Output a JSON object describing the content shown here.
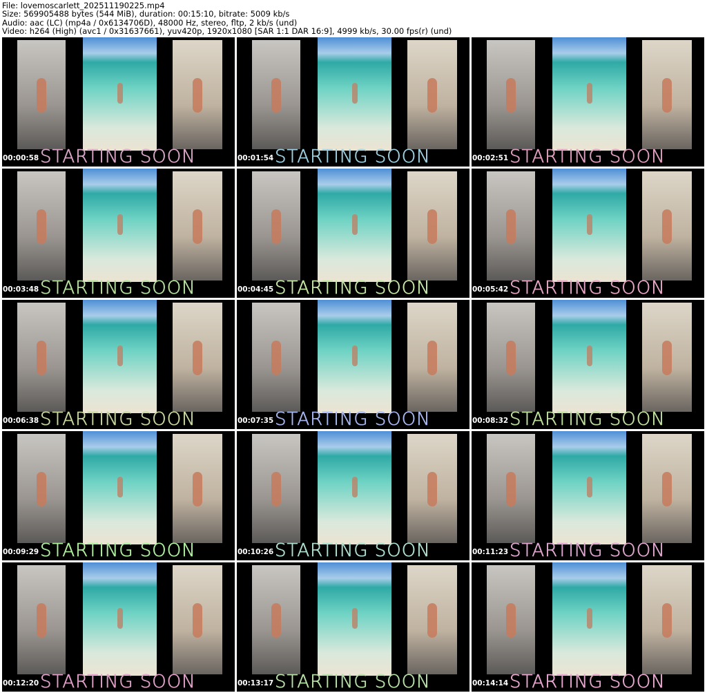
{
  "header": {
    "file": "File: lovemoscarlett_202511190225.mp4",
    "size": "Size: 569905488 bytes (544 MiB), duration: 00:15:10, bitrate: 5009 kb/s",
    "audio": "Audio: aac (LC) (mp4a / 0x6134706D), 48000 Hz, stereo, fltp, 2 kb/s (und)",
    "video": "Video: h264 (High) (avc1 / 0x31637661), yuv420p, 1920x1080 [SAR 1:1 DAR 16:9], 4999 kb/s, 30.00 fps(r) (und)"
  },
  "overlay_text": "STARTING SOON",
  "thumbnails": [
    {
      "time": "00:00:58",
      "color": "#d9a6c8"
    },
    {
      "time": "00:01:54",
      "color": "#9fd0e0"
    },
    {
      "time": "00:02:51",
      "color": "#e0a0c0"
    },
    {
      "time": "00:03:48",
      "color": "#b8e0a0"
    },
    {
      "time": "00:04:45",
      "color": "#c8e8a8"
    },
    {
      "time": "00:05:42",
      "color": "#e8a8c8"
    },
    {
      "time": "00:06:38",
      "color": "#c8d8a0"
    },
    {
      "time": "00:07:35",
      "color": "#a8b8f0"
    },
    {
      "time": "00:08:32",
      "color": "#c0e0a0"
    },
    {
      "time": "00:09:29",
      "color": "#b0f0a0"
    },
    {
      "time": "00:10:26",
      "color": "#b0e0d0"
    },
    {
      "time": "00:11:23",
      "color": "#e0a8d0"
    },
    {
      "time": "00:12:20",
      "color": "#e0a0c8"
    },
    {
      "time": "00:13:17",
      "color": "#b8e0a8"
    },
    {
      "time": "00:14:14",
      "color": "#e8a8d0"
    }
  ]
}
